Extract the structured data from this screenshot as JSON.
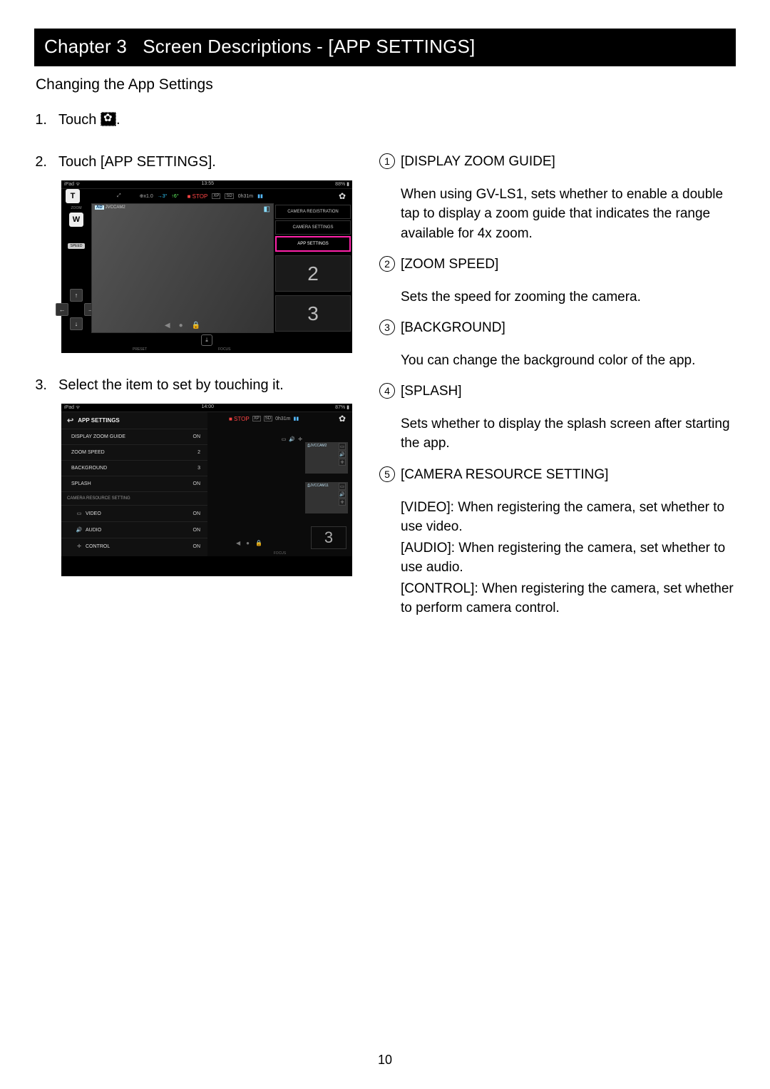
{
  "chapter": {
    "label": "Chapter 3",
    "title": "Screen Descriptions - [APP SETTINGS]"
  },
  "section_title": "Changing the App Settings",
  "steps": {
    "s1": {
      "num": "1.",
      "text_a": "Touch ",
      "text_b": "."
    },
    "s2": {
      "num": "2.",
      "text": "Touch [APP SETTINGS]."
    },
    "s3": {
      "num": "3.",
      "text": "Select the item to set by touching it."
    }
  },
  "shot1": {
    "status_left": "iPad ᯤ",
    "status_center": "13:55",
    "status_right": "88% ▮",
    "t_btn": "T",
    "w_btn": "W",
    "zoom_lbl": "ZOOM",
    "top_icons": {
      "expand": "⤢",
      "mag": "⊕x1.0",
      "arrow": "→3°",
      "up": "↑6°"
    },
    "stop": "■ STOP",
    "xp": "XP",
    "sd": "SD",
    "time": "0h31m",
    "batt": "▮▮",
    "cam_ad": "AD",
    "cam_name": "JVCCAM2",
    "speed": "SPEED",
    "arrows": {
      "up": "↑",
      "left": "←",
      "right": "→",
      "down": "↓"
    },
    "menu": {
      "reg": "CAMERA REGISTRATION",
      "set": "CAMERA SETTINGS",
      "app": "APP SETTINGS"
    },
    "big2": "2",
    "big3": "3",
    "foot_preset": "PRESET",
    "foot_focus": "FOCUS"
  },
  "shot2": {
    "status_left": "iPad ᯤ",
    "status_center": "14:00",
    "status_right": "87% ▮",
    "header": "APP SETTINGS",
    "rows": {
      "dzg": {
        "label": "DISPLAY ZOOM GUIDE",
        "val": "ON"
      },
      "zs": {
        "label": "ZOOM SPEED",
        "val": "2"
      },
      "bg": {
        "label": "BACKGROUND",
        "val": "3"
      },
      "sp": {
        "label": "SPLASH",
        "val": "ON"
      }
    },
    "section": "CAMERA RESOURCE SETTING",
    "res": {
      "video": {
        "label": "VIDEO",
        "val": "ON"
      },
      "audio": {
        "label": "AUDIO",
        "val": "ON"
      },
      "control": {
        "label": "CONTROL",
        "val": "ON"
      }
    },
    "r_stop": "■ STOP",
    "r_xp": "XP",
    "r_sd": "SD",
    "r_time": "0h31m",
    "thumb1": "JVCCAM2",
    "thumb2": "JVCCAM11",
    "r_big": "3",
    "r_focus": "FOCUS"
  },
  "defs": {
    "d1": {
      "label": "[DISPLAY ZOOM GUIDE]",
      "desc": "When using GV-LS1, sets whether to enable a double tap to display a zoom guide that indicates the range available for 4x zoom."
    },
    "d2": {
      "label": "[ZOOM SPEED]",
      "desc": "Sets the speed for zooming the camera."
    },
    "d3": {
      "label": "[BACKGROUND]",
      "desc": "You can change the background color of the app."
    },
    "d4": {
      "label": "[SPLASH]",
      "desc": "Sets whether to display the splash screen after starting the app."
    },
    "d5": {
      "label": "[CAMERA RESOURCE SETTING]",
      "l1": "[VIDEO]: When registering the camera, set whether to use video.",
      "l2": "[AUDIO]: When registering the camera, set whether to use audio.",
      "l3": "[CONTROL]: When registering the camera, set whether to perform camera control."
    }
  },
  "page_number": "10"
}
